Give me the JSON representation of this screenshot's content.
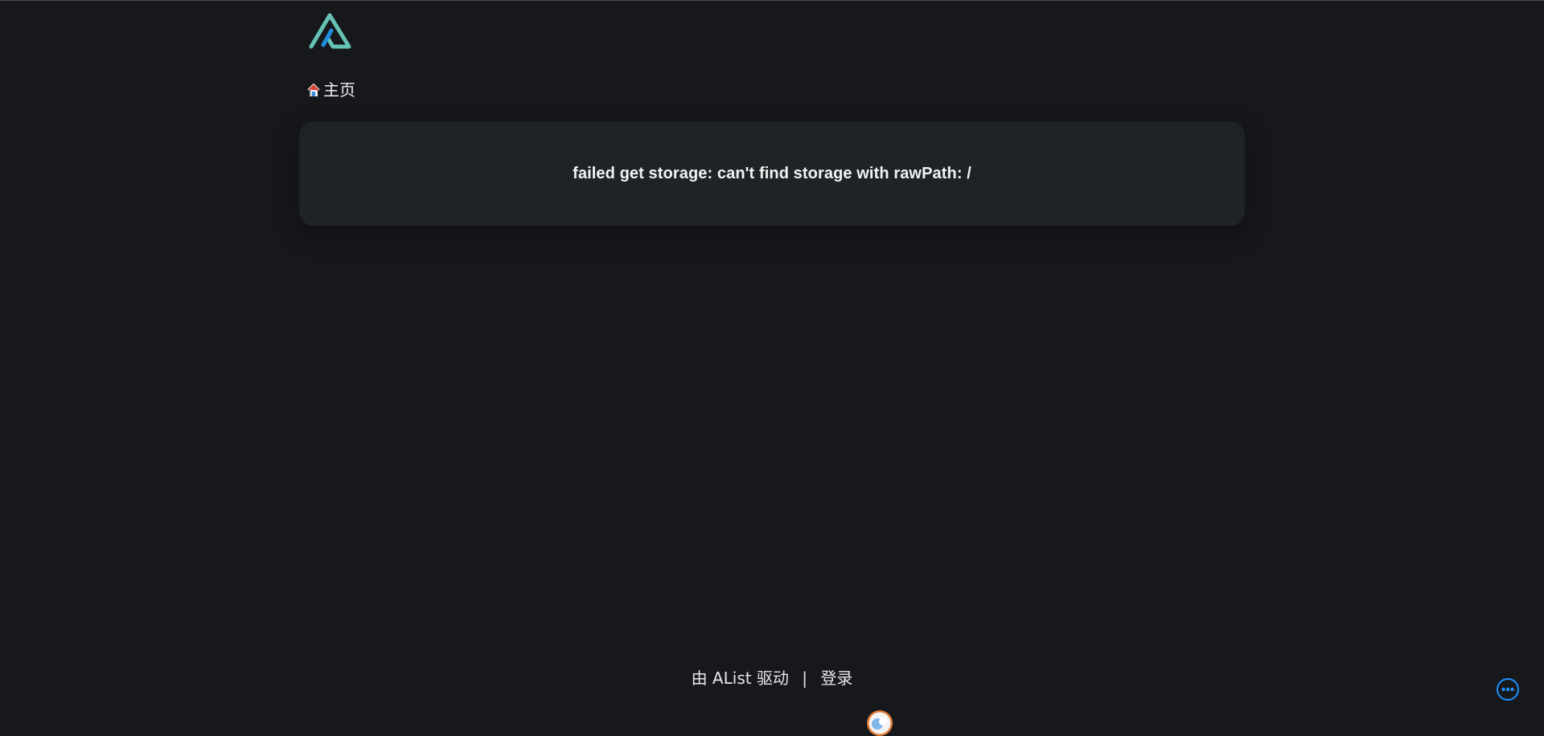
{
  "header": {
    "logo_icon": "alist-logo-icon",
    "brand_colors": {
      "teal": "#64c3b6",
      "blue": "#1f8fe0"
    }
  },
  "breadcrumb": {
    "home_icon": "house-icon",
    "home_label": "主页"
  },
  "error": {
    "message": "failed get storage: can't find storage with rawPath: /"
  },
  "footer": {
    "powered_by": "由 AList 驱动",
    "separator": "|",
    "login_label": "登录"
  },
  "floating": {
    "more_icon": "more-options-icon",
    "accent_color": "#1e90ff",
    "avatar_icon": "avatar-icon"
  }
}
